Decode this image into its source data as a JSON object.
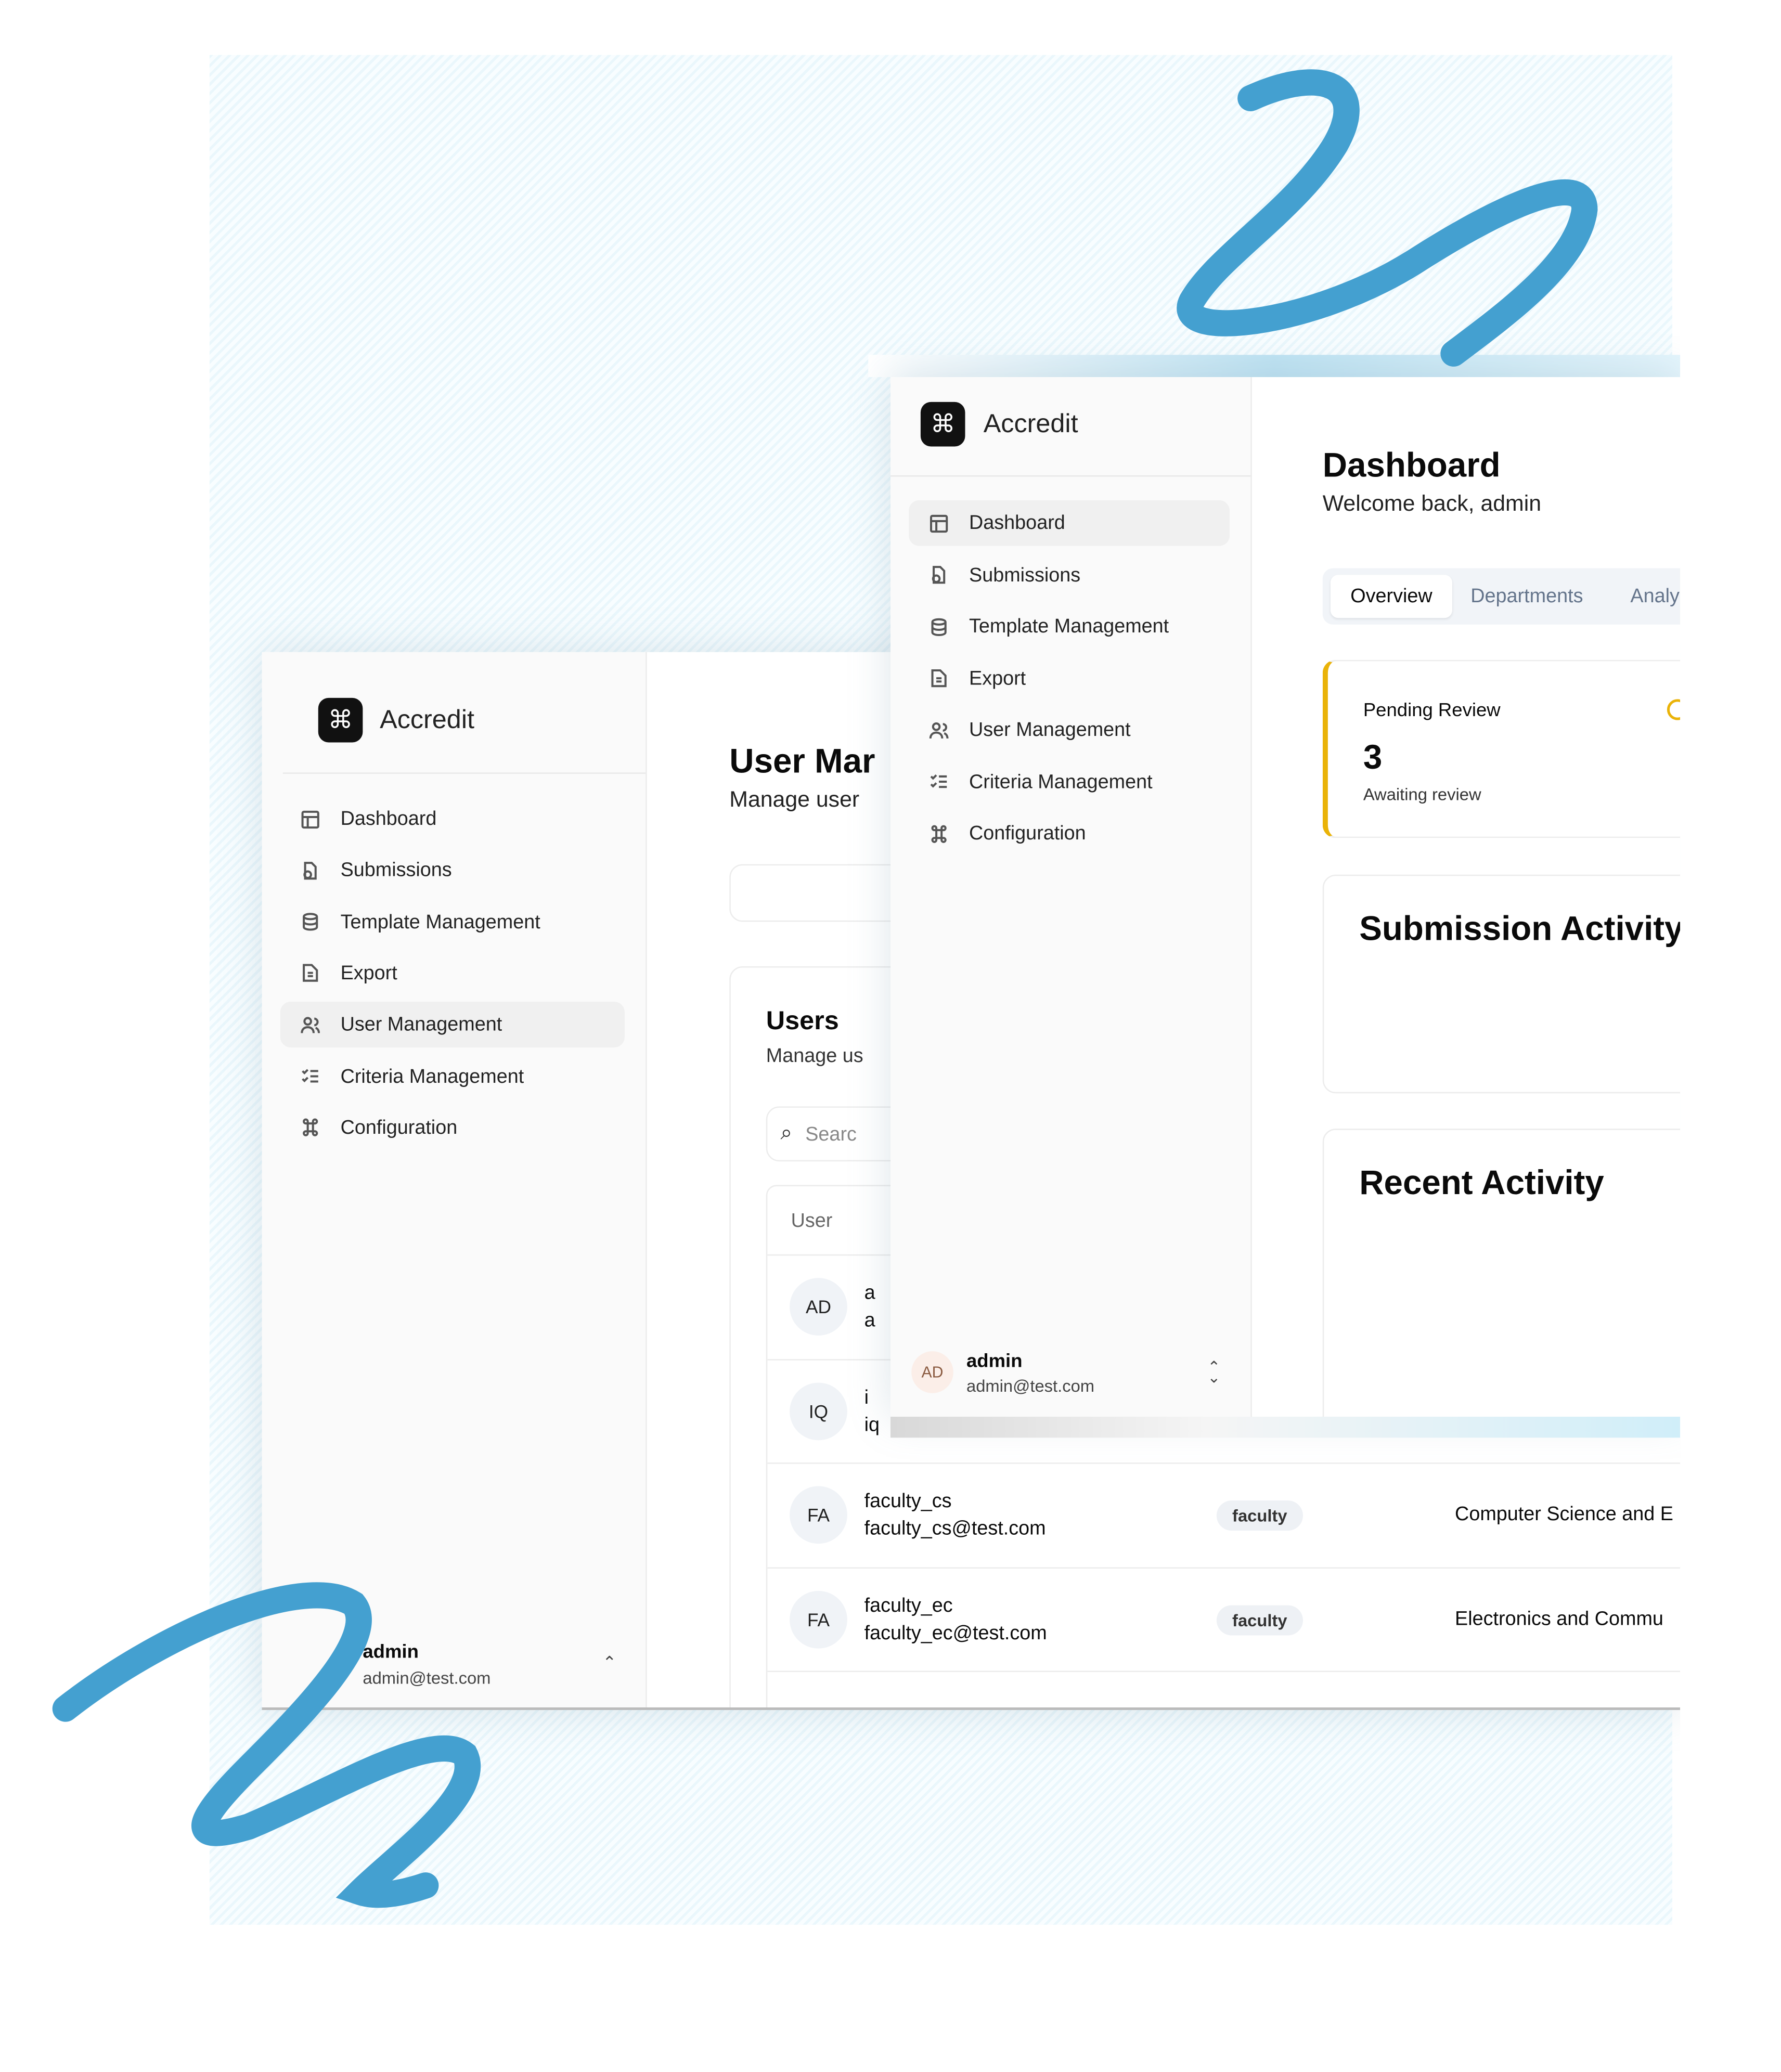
{
  "brand": "Accredit",
  "nav": [
    "Dashboard",
    "Submissions",
    "Template Management",
    "Export",
    "User Management",
    "Criteria Management",
    "Configuration"
  ],
  "nav_icons": [
    "layout-icon",
    "file-clock-icon",
    "database-icon",
    "file-text-icon",
    "users-icon",
    "list-checks-icon",
    "command-icon"
  ],
  "user": {
    "initials": "AD",
    "name": "admin",
    "email": "admin@test.com"
  },
  "user_mgmt": {
    "title": "User Mar",
    "subtitle": "Manage user",
    "card_title": "Users",
    "card_subtitle": "Manage us",
    "search_placeholder": "Searc",
    "col_user": "User",
    "rows": [
      {
        "initials": "AD",
        "name": "a",
        "email": "a"
      },
      {
        "initials": "IQ",
        "name": "i",
        "email": "iq"
      },
      {
        "initials": "FA",
        "name": "faculty_cs",
        "email": "faculty_cs@test.com",
        "role": "faculty",
        "department": "Computer Science and E"
      },
      {
        "initials": "FA",
        "name": "faculty_ec",
        "email": "faculty_ec@test.com",
        "role": "faculty",
        "department": "Electronics and Commu"
      }
    ]
  },
  "dashboard": {
    "title": "Dashboard",
    "subtitle": "Welcome back, admin",
    "tabs": [
      "Overview",
      "Departments",
      "Analy"
    ],
    "pending": {
      "label": "Pending Review",
      "value": "3",
      "note": "Awaiting review"
    },
    "submission_activity": "Submission Activity",
    "recent_activity": "Recent Activity"
  },
  "colors": {
    "accent_yellow": "#eab308",
    "scribble": "#44a0d0"
  }
}
